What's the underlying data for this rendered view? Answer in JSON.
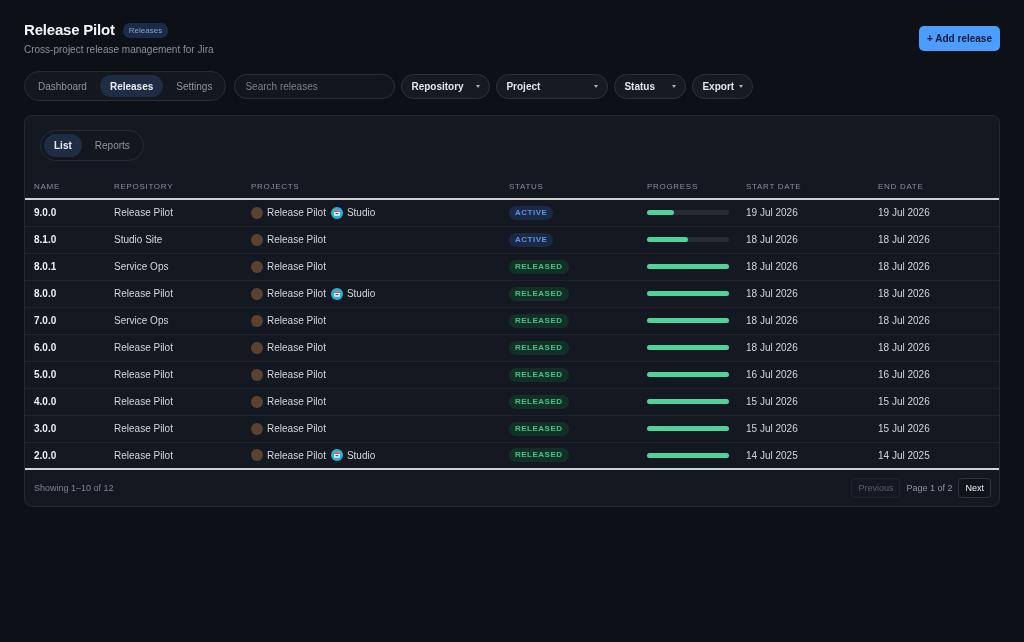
{
  "header": {
    "title": "Release Pilot",
    "badge": "Releases",
    "subtitle": "Cross-project release management for Jira",
    "action": "+ Add release"
  },
  "nav_tabs": [
    {
      "label": "Dashboard",
      "selected": false
    },
    {
      "label": "Releases",
      "selected": true
    },
    {
      "label": "Settings",
      "selected": false
    }
  ],
  "search": {
    "placeholder": "Search releases"
  },
  "filters": [
    {
      "label": "Repository"
    },
    {
      "label": "Project"
    },
    {
      "label": "Status"
    },
    {
      "label": "Export"
    }
  ],
  "view_tabs": [
    {
      "label": "List",
      "selected": true
    },
    {
      "label": "Reports",
      "selected": false
    }
  ],
  "table": {
    "columns": [
      "NAME",
      "REPOSITORY",
      "PROJECTS",
      "STATUS",
      "PROGRESS",
      "START DATE",
      "END DATE"
    ],
    "rows": [
      {
        "name": "9.0.0",
        "repository": "Release Pilot",
        "projects": [
          {
            "name": "Release Pilot",
            "kind": "avatar"
          },
          {
            "name": "Studio",
            "kind": "logo"
          }
        ],
        "status": {
          "label": "ACTIVE",
          "kind": "active"
        },
        "level": 0.33,
        "start_date": "19 Jul 2026",
        "end_date": "19 Jul 2026"
      },
      {
        "name": "8.1.0",
        "repository": "Studio Site",
        "projects": [
          {
            "name": "Release Pilot",
            "kind": "avatar"
          }
        ],
        "status": {
          "label": "ACTIVE",
          "kind": "active"
        },
        "level": 0.5,
        "start_date": "18 Jul 2026",
        "end_date": "18 Jul 2026"
      },
      {
        "name": "8.0.1",
        "repository": "Service Ops",
        "projects": [
          {
            "name": "Release Pilot",
            "kind": "avatar"
          }
        ],
        "status": {
          "label": "RELEASED",
          "kind": "released"
        },
        "level": 1,
        "start_date": "18 Jul 2026",
        "end_date": "18 Jul 2026"
      },
      {
        "name": "8.0.0",
        "repository": "Release Pilot",
        "projects": [
          {
            "name": "Release Pilot",
            "kind": "avatar"
          },
          {
            "name": "Studio",
            "kind": "logo"
          }
        ],
        "status": {
          "label": "RELEASED",
          "kind": "released"
        },
        "level": 1,
        "start_date": "18 Jul 2026",
        "end_date": "18 Jul 2026"
      },
      {
        "name": "7.0.0",
        "repository": "Service Ops",
        "projects": [
          {
            "name": "Release Pilot",
            "kind": "avatar"
          }
        ],
        "status": {
          "label": "RELEASED",
          "kind": "released"
        },
        "level": 1,
        "start_date": "18 Jul 2026",
        "end_date": "18 Jul 2026"
      },
      {
        "name": "6.0.0",
        "repository": "Release Pilot",
        "projects": [
          {
            "name": "Release Pilot",
            "kind": "avatar"
          }
        ],
        "status": {
          "label": "RELEASED",
          "kind": "released"
        },
        "level": 1,
        "start_date": "18 Jul 2026",
        "end_date": "18 Jul 2026"
      },
      {
        "name": "5.0.0",
        "repository": "Release Pilot",
        "projects": [
          {
            "name": "Release Pilot",
            "kind": "avatar"
          }
        ],
        "status": {
          "label": "RELEASED",
          "kind": "released"
        },
        "level": 1,
        "start_date": "16 Jul 2026",
        "end_date": "16 Jul 2026"
      },
      {
        "name": "4.0.0",
        "repository": "Release Pilot",
        "projects": [
          {
            "name": "Release Pilot",
            "kind": "avatar"
          }
        ],
        "status": {
          "label": "RELEASED",
          "kind": "released"
        },
        "level": 1,
        "start_date": "15 Jul 2026",
        "end_date": "15 Jul 2026"
      },
      {
        "name": "3.0.0",
        "repository": "Release Pilot",
        "projects": [
          {
            "name": "Release Pilot",
            "kind": "avatar"
          }
        ],
        "status": {
          "label": "RELEASED",
          "kind": "released"
        },
        "level": 1,
        "start_date": "15 Jul 2026",
        "end_date": "15 Jul 2026"
      },
      {
        "name": "2.0.0",
        "repository": "Release Pilot",
        "projects": [
          {
            "name": "Release Pilot",
            "kind": "avatar"
          },
          {
            "name": "Studio",
            "kind": "logo"
          }
        ],
        "status": {
          "label": "RELEASED",
          "kind": "released"
        },
        "level": 1,
        "start_date": "14 Jul 2025",
        "end_date": "14 Jul 2025"
      }
    ]
  },
  "footer": {
    "summary": "Showing 1–10 of 12",
    "previous": {
      "label": "Previous",
      "disabled": true
    },
    "page": "Page 1 of 2",
    "next": {
      "label": "Next",
      "disabled": false
    }
  }
}
